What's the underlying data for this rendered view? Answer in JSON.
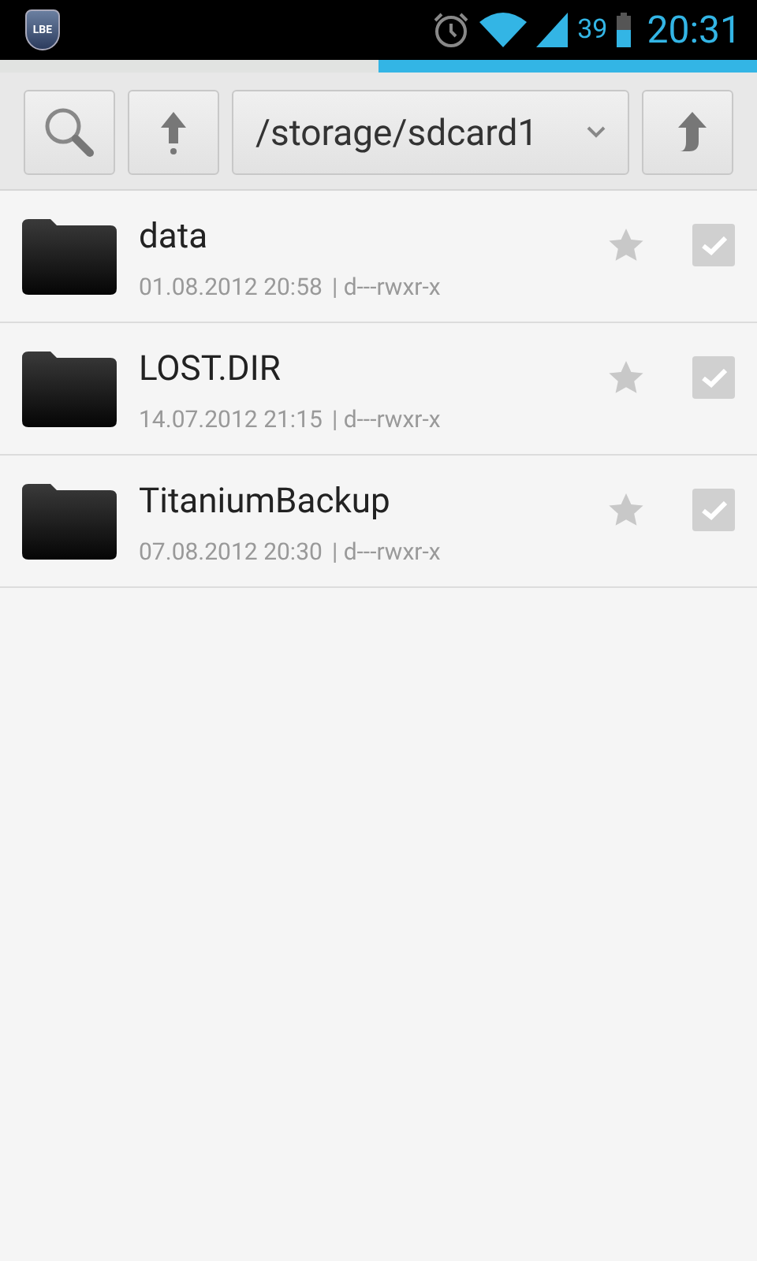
{
  "status_bar": {
    "app_badge": "LBE",
    "battery": "39",
    "time": "20:31"
  },
  "progress": {
    "level": 0.5
  },
  "toolbar": {
    "path": "/storage/sdcard1"
  },
  "files": [
    {
      "name": "data",
      "date": "01.08.2012 20:58",
      "perms": "| d---rwxr-x",
      "starred": false,
      "checked": false
    },
    {
      "name": "LOST.DIR",
      "date": "14.07.2012 21:15",
      "perms": "| d---rwxr-x",
      "starred": false,
      "checked": false
    },
    {
      "name": "TitaniumBackup",
      "date": "07.08.2012 20:30",
      "perms": "| d---rwxr-x",
      "starred": false,
      "checked": false
    }
  ]
}
